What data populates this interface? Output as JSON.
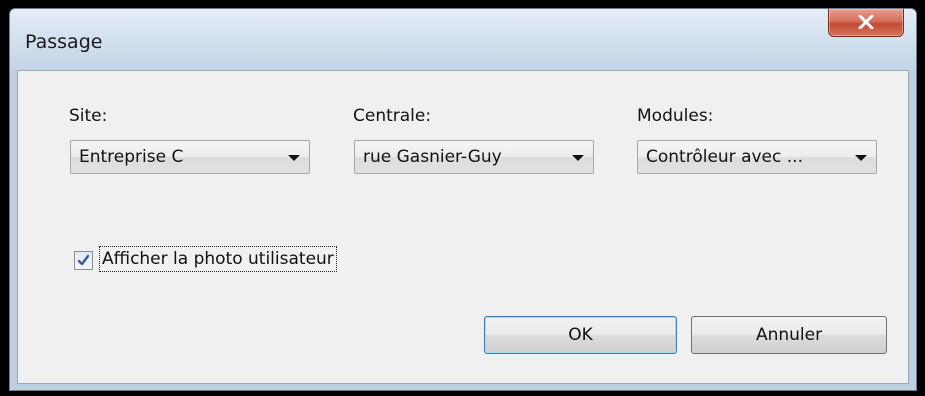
{
  "window": {
    "title": "Passage"
  },
  "fields": {
    "site": {
      "label": "Site:",
      "value": "Entreprise C"
    },
    "centrale": {
      "label": "Centrale:",
      "value": "rue Gasnier-Guy"
    },
    "modules": {
      "label": "Modules:",
      "value": "Contrôleur avec ..."
    }
  },
  "options": {
    "show_photo": {
      "label": "Afficher la photo utilisateur",
      "checked": true
    }
  },
  "buttons": {
    "ok": "OK",
    "cancel": "Annuler"
  },
  "icons": {
    "close": "close-icon",
    "dropdown": "chevron-down-icon",
    "check": "checkmark-icon"
  },
  "colors": {
    "close_button": "#c44a33",
    "checkmark": "#3b5a9a",
    "default_button_border": "#3c7fb1"
  }
}
